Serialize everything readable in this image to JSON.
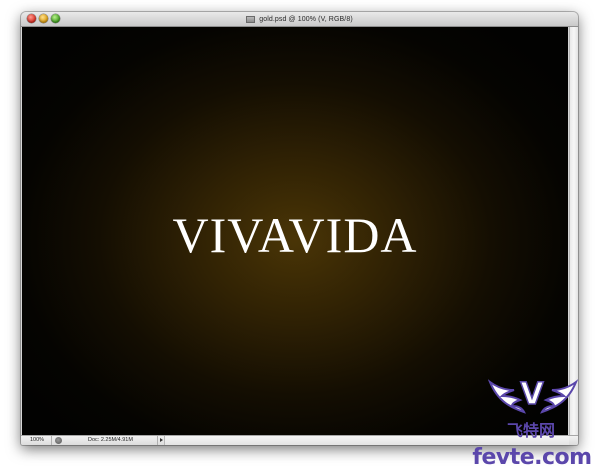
{
  "window": {
    "title": "gold.psd @ 100% (V, RGB/8)"
  },
  "canvas": {
    "headline": "VIVAVIDA"
  },
  "statusbar": {
    "zoom": "100%",
    "doc_size": "Doc: 2.25M/4.91M"
  },
  "watermark": {
    "letter": "V",
    "cn_name": "飞特网",
    "url": "fevte.com"
  },
  "colors": {
    "accent_watermark": "#5b47ab",
    "canvas_glow": "#4a3506",
    "canvas_edge": "#020201"
  }
}
